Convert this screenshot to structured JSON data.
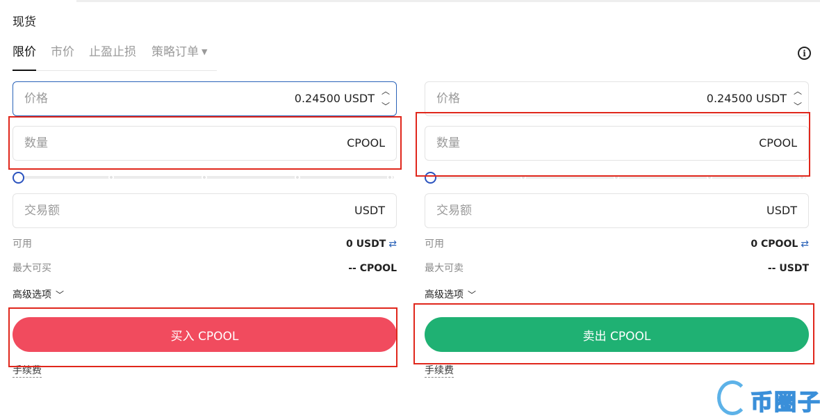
{
  "section_title": "现货",
  "tabs": [
    {
      "label": "限价",
      "active": true
    },
    {
      "label": "市价",
      "active": false
    },
    {
      "label": "止盈止损",
      "active": false
    },
    {
      "label": "策略订单",
      "active": false
    }
  ],
  "info_icon": "info-icon",
  "buy": {
    "price_label": "价格",
    "price_value": "0.24500 USDT",
    "amount_label": "数量",
    "amount_unit": "CPOOL",
    "slider_value_percent": 0,
    "total_label": "交易额",
    "total_unit": "USDT",
    "available_label": "可用",
    "available_value": "0 USDT",
    "max_label": "最大可买",
    "max_value": "-- CPOOL",
    "advanced_label": "高级选项",
    "button_label": "买入 CPOOL",
    "fee_label": "手续费",
    "button_color": "#f14b5e"
  },
  "sell": {
    "price_label": "价格",
    "price_value": "0.24500 USDT",
    "amount_label": "数量",
    "amount_unit": "CPOOL",
    "slider_value_percent": 0,
    "total_label": "交易额",
    "total_unit": "USDT",
    "available_label": "可用",
    "available_value": "0 CPOOL",
    "max_label": "最大可卖",
    "max_value": "-- USDT",
    "advanced_label": "高级选项",
    "button_label": "卖出 CPOOL",
    "fee_label": "手续费",
    "button_color": "#1fb173"
  },
  "watermark_text": "币圈子",
  "colors": {
    "accent_blue": "#2a62b8",
    "highlight_red": "#e0261b"
  }
}
